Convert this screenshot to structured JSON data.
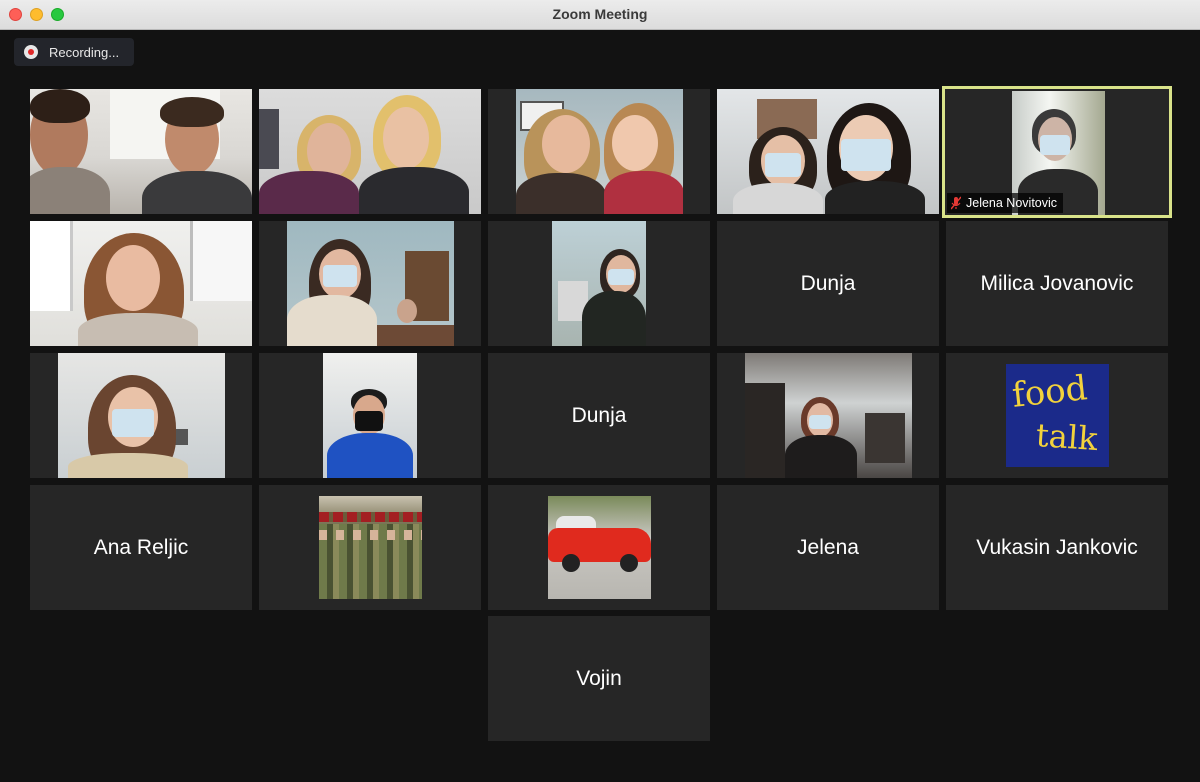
{
  "window": {
    "title": "Zoom Meeting"
  },
  "recording": {
    "label": "Recording...",
    "icon": "record-icon"
  },
  "participants": [
    {
      "name": "",
      "video": true
    },
    {
      "name": "",
      "video": true
    },
    {
      "name": "",
      "video": true
    },
    {
      "name": "",
      "video": true
    },
    {
      "name": "Jelena Novitovic",
      "video": true,
      "muted": true,
      "active_speaker": true
    },
    {
      "name": "",
      "video": true
    },
    {
      "name": "",
      "video": true
    },
    {
      "name": "",
      "video": true
    },
    {
      "name": "Dunja",
      "video": false
    },
    {
      "name": "Milica Jovanovic",
      "video": false
    },
    {
      "name": "",
      "video": true
    },
    {
      "name": "",
      "video": true
    },
    {
      "name": "Dunja",
      "video": false
    },
    {
      "name": "",
      "video": true
    },
    {
      "name": "",
      "profile_image": "food-talk-logo"
    },
    {
      "name": "Ana Reljic",
      "video": false
    },
    {
      "name": "",
      "profile_image": "soldiers-photo"
    },
    {
      "name": "",
      "profile_image": "red-car-photo"
    },
    {
      "name": "Jelena",
      "video": false
    },
    {
      "name": "Vukasin Jankovic",
      "video": false
    },
    {
      "name": "Vojin",
      "video": false
    }
  ],
  "logo": {
    "line1": "food",
    "line2": "talk"
  },
  "colors": {
    "active_border": "#d9e38a",
    "tile_bg": "#262626",
    "background": "#121212",
    "logo_bg": "#1b2a8a",
    "logo_text": "#f2d23c"
  }
}
